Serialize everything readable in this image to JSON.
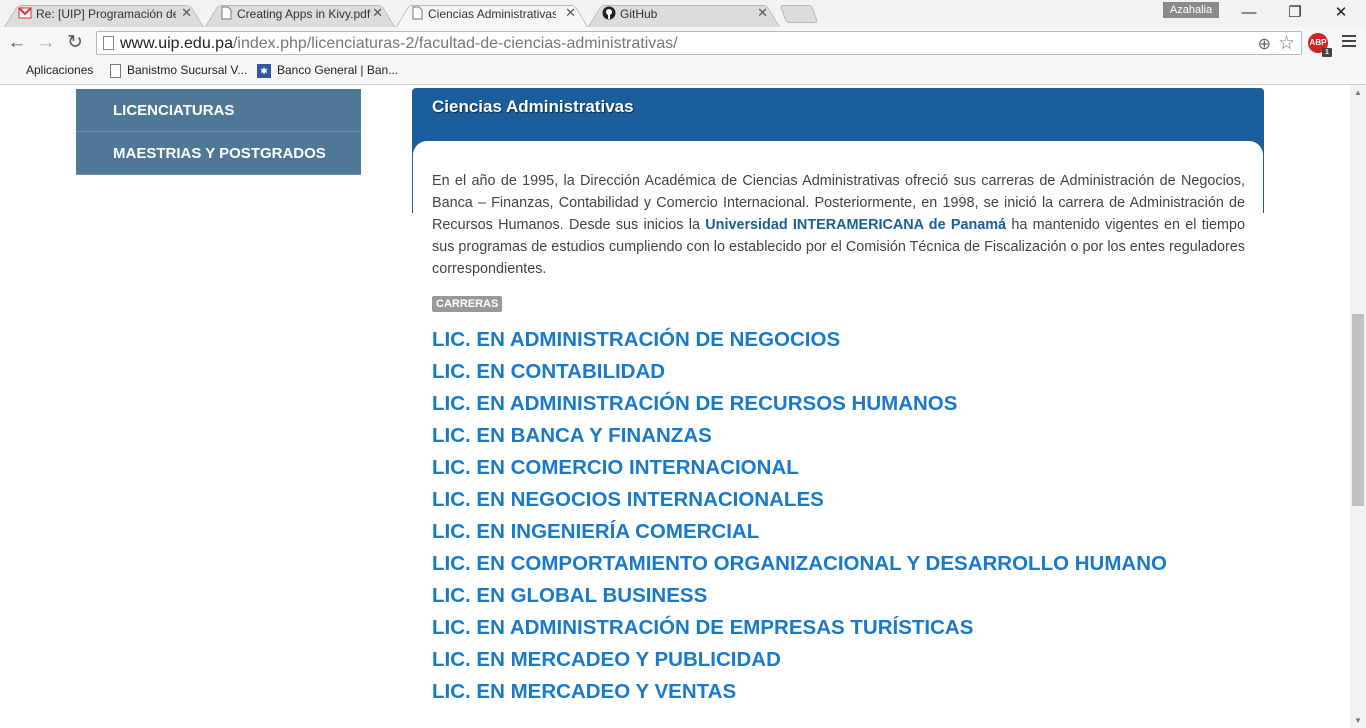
{
  "browser": {
    "tabs": [
      {
        "title": "Re: [UIP] Programación de",
        "icon": "gmail-icon",
        "active": false
      },
      {
        "title": "Creating Apps in Kivy.pdf",
        "icon": "document-icon",
        "active": false
      },
      {
        "title": "Ciencias Administrativas |",
        "icon": "document-icon",
        "active": true
      },
      {
        "title": "GitHub",
        "icon": "github-icon",
        "active": false
      }
    ],
    "profile_name": "Azahalia",
    "url_domain": "www.uip.edu.pa",
    "url_path": "/index.php/licenciaturas-2/facultad-de-ciencias-administrativas/",
    "extension_badge": "ABP",
    "extension_count": "1",
    "bookmarks": [
      {
        "label": "Aplicaciones",
        "icon": "apps-grid-icon"
      },
      {
        "label": "Banistmo Sucursal V...",
        "icon": "document-icon"
      },
      {
        "label": "Banco General | Ban...",
        "icon": "bank-icon"
      }
    ]
  },
  "sidebar": {
    "items": [
      {
        "label": "LICENCIATURAS"
      },
      {
        "label": "MAESTRIAS Y POSTGRADOS"
      }
    ]
  },
  "content": {
    "title": "Ciencias Administrativas",
    "paragraph_part1": "En el año de 1995, la Dirección Académica de Ciencias Administrativas ofreció sus carreras de Administración de Negocios, Banca – Finanzas, Contabilidad y Comercio Internacional.  Posteriormente, en 1998, se inició la carrera de Administración de Recursos Humanos. Desde sus inicios la ",
    "paragraph_university": "Universidad INTERAMERICANA de Panamá",
    "paragraph_part2": " ha mantenido vigentes en el tiempo sus programas de estudios cumpliendo con lo establecido por el Comisión Técnica de Fiscalización o por los entes reguladores correspondientes.",
    "badge": "CARRERAS",
    "careers": [
      "LIC. EN ADMINISTRACIÓN DE NEGOCIOS",
      "LIC. EN CONTABILIDAD",
      "LIC. EN ADMINISTRACIÓN DE RECURSOS HUMANOS",
      "LIC. EN BANCA Y FINANZAS",
      "LIC. EN COMERCIO INTERNACIONAL",
      "LIC. EN NEGOCIOS INTERNACIONALES",
      "LIC. EN INGENIERÍA COMERCIAL",
      "LIC. EN COMPORTAMIENTO ORGANIZACIONAL Y DESARROLLO HUMANO",
      "LIC. EN GLOBAL BUSINESS",
      "LIC. EN ADMINISTRACIÓN DE EMPRESAS TURÍSTICAS",
      "LIC. EN MERCADEO Y PUBLICIDAD",
      "LIC. EN MERCADEO Y VENTAS"
    ]
  },
  "colors": {
    "panel_header": "#1a5e9c",
    "sidebar": "#4f7896",
    "career_link": "#1a7ac9"
  }
}
